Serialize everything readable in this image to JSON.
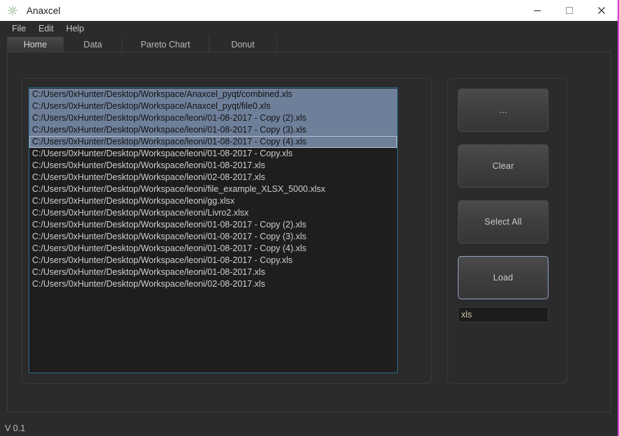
{
  "window": {
    "title": "Anaxcel",
    "icon": "starburst-icon",
    "controls": {
      "minimize": "minimize-icon",
      "maximize": "maximize-icon",
      "close": "close-icon"
    },
    "accent_border_color": "#d23fd2"
  },
  "menubar": {
    "items": [
      {
        "label": "File"
      },
      {
        "label": "Edit"
      },
      {
        "label": "Help"
      }
    ]
  },
  "tabs": {
    "active": "Home",
    "items": [
      {
        "label": "Home"
      },
      {
        "label": "Data"
      },
      {
        "label": "Pareto Chart"
      },
      {
        "label": "Donut"
      }
    ]
  },
  "file_list": {
    "selection_color": "#6e7f99",
    "background_color": "#1e1e1e",
    "border_color": "#2f6b8f",
    "focused_index": 4,
    "rows": [
      {
        "path": "C:/Users/0xHunter/Desktop/Workspace/Anaxcel_pyqt/combined.xls",
        "selected": true
      },
      {
        "path": "C:/Users/0xHunter/Desktop/Workspace/Anaxcel_pyqt/file0.xls",
        "selected": true
      },
      {
        "path": "C:/Users/0xHunter/Desktop/Workspace/leoni/01-08-2017 - Copy (2).xls",
        "selected": true
      },
      {
        "path": "C:/Users/0xHunter/Desktop/Workspace/leoni/01-08-2017 - Copy (3).xls",
        "selected": true
      },
      {
        "path": "C:/Users/0xHunter/Desktop/Workspace/leoni/01-08-2017 - Copy (4).xls",
        "selected": true
      },
      {
        "path": "C:/Users/0xHunter/Desktop/Workspace/leoni/01-08-2017 - Copy.xls",
        "selected": false
      },
      {
        "path": "C:/Users/0xHunter/Desktop/Workspace/leoni/01-08-2017.xls",
        "selected": false
      },
      {
        "path": "C:/Users/0xHunter/Desktop/Workspace/leoni/02-08-2017.xls",
        "selected": false
      },
      {
        "path": "C:/Users/0xHunter/Desktop/Workspace/leoni/file_example_XLSX_5000.xlsx",
        "selected": false
      },
      {
        "path": "C:/Users/0xHunter/Desktop/Workspace/leoni/gg.xlsx",
        "selected": false
      },
      {
        "path": "C:/Users/0xHunter/Desktop/Workspace/leoni/Livro2.xlsx",
        "selected": false
      },
      {
        "path": "C:/Users/0xHunter/Desktop/Workspace/leoni/01-08-2017 - Copy (2).xls",
        "selected": false
      },
      {
        "path": "C:/Users/0xHunter/Desktop/Workspace/leoni/01-08-2017 - Copy (3).xls",
        "selected": false
      },
      {
        "path": "C:/Users/0xHunter/Desktop/Workspace/leoni/01-08-2017 - Copy (4).xls",
        "selected": false
      },
      {
        "path": "C:/Users/0xHunter/Desktop/Workspace/leoni/01-08-2017 - Copy.xls",
        "selected": false
      },
      {
        "path": "C:/Users/0xHunter/Desktop/Workspace/leoni/01-08-2017.xls",
        "selected": false
      },
      {
        "path": "C:/Users/0xHunter/Desktop/Workspace/leoni/02-08-2017.xls",
        "selected": false
      }
    ]
  },
  "actions": {
    "browse_label": "...",
    "clear_label": "Clear",
    "select_all_label": "Select All",
    "load_label": "Load",
    "filter_value": "xls",
    "filter_placeholder": "xls"
  },
  "statusbar": {
    "version": "V 0.1"
  }
}
